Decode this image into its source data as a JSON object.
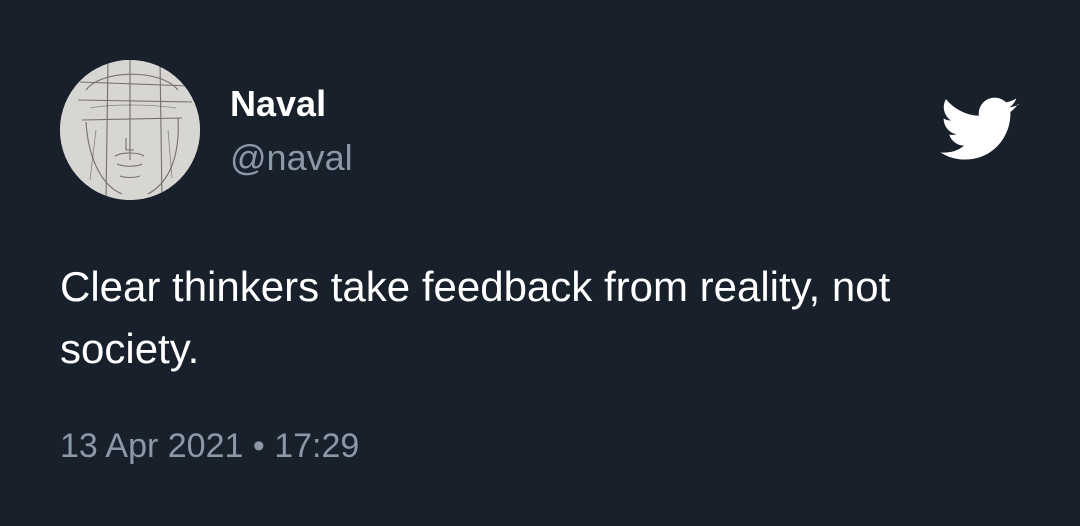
{
  "author": {
    "name": "Naval",
    "handle": "@naval"
  },
  "tweet": {
    "text": "Clear thinkers take feedback from reality, not society.",
    "date": "13 Apr 2021",
    "separator": "•",
    "time": "17:29"
  },
  "icons": {
    "brand": "twitter-bird-icon",
    "avatar": "sketch-face-avatar"
  },
  "colors": {
    "background": "#17202b",
    "primary_text": "#ffffff",
    "secondary_text": "#8b98a5"
  }
}
